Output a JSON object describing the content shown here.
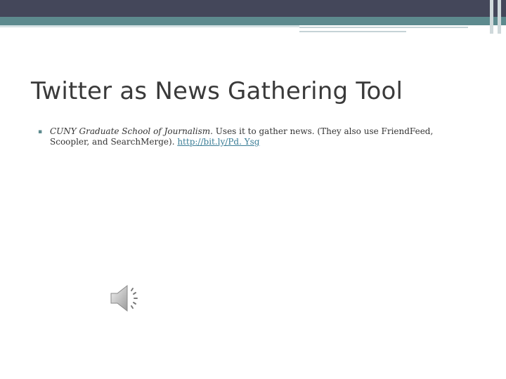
{
  "slide": {
    "title": "Twitter as News Gathering Tool",
    "bullet": {
      "org_name": "CUNY Graduate School of Journalism",
      "text_after_org": ". Uses it to gather news. (They also use FriendFeed, Scoopler, and SearchMerge). ",
      "link_text": "http://bit.ly/Pd. Ysg"
    },
    "audio_icon": "speaker-icon"
  },
  "colors": {
    "header_dark": "#44475a",
    "header_teal": "#5d8a8e",
    "link": "#3a7d96"
  }
}
